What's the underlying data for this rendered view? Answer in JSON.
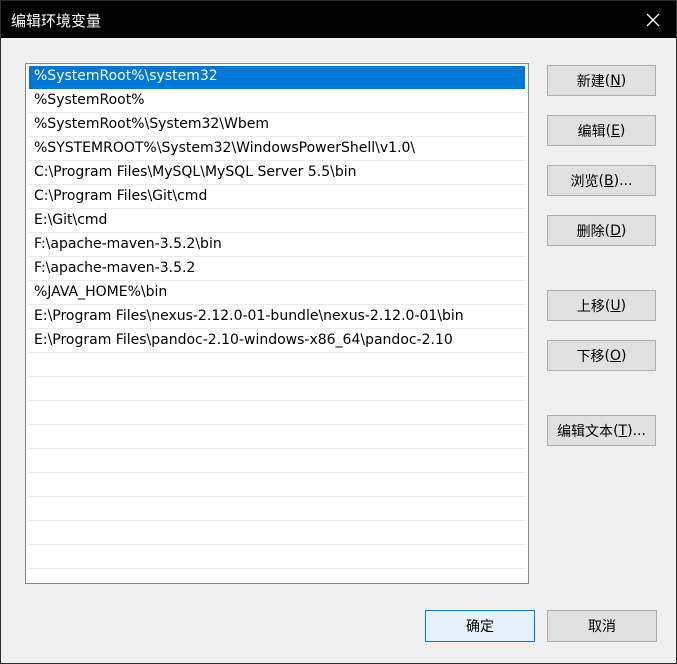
{
  "window": {
    "title": "编辑环境变量"
  },
  "paths": [
    "%SystemRoot%\\system32",
    "%SystemRoot%",
    "%SystemRoot%\\System32\\Wbem",
    "%SYSTEMROOT%\\System32\\WindowsPowerShell\\v1.0\\",
    "C:\\Program Files\\MySQL\\MySQL Server 5.5\\bin",
    "C:\\Program Files\\Git\\cmd",
    "E:\\Git\\cmd",
    "F:\\apache-maven-3.5.2\\bin",
    "F:\\apache-maven-3.5.2",
    "%JAVA_HOME%\\bin",
    "E:\\Program Files\\nexus-2.12.0-01-bundle\\nexus-2.12.0-01\\bin",
    "E:\\Program Files\\pandoc-2.10-windows-x86_64\\pandoc-2.10"
  ],
  "selected_index": 0,
  "buttons": {
    "new": {
      "label": "新建",
      "key": "N",
      "suffix": ""
    },
    "edit": {
      "label": "编辑",
      "key": "E",
      "suffix": ""
    },
    "browse": {
      "label": "浏览",
      "key": "B",
      "suffix": "..."
    },
    "delete": {
      "label": "删除",
      "key": "D",
      "suffix": ""
    },
    "move_up": {
      "label": "上移",
      "key": "U",
      "suffix": ""
    },
    "move_down": {
      "label": "下移",
      "key": "O",
      "suffix": ""
    },
    "edit_text": {
      "label": "编辑文本",
      "key": "T",
      "suffix": "..."
    },
    "ok": "确定",
    "cancel": "取消"
  },
  "colors": {
    "selection": "#0078d7",
    "titlebar": "#000000",
    "dialog_bg": "#f0f0f0"
  }
}
